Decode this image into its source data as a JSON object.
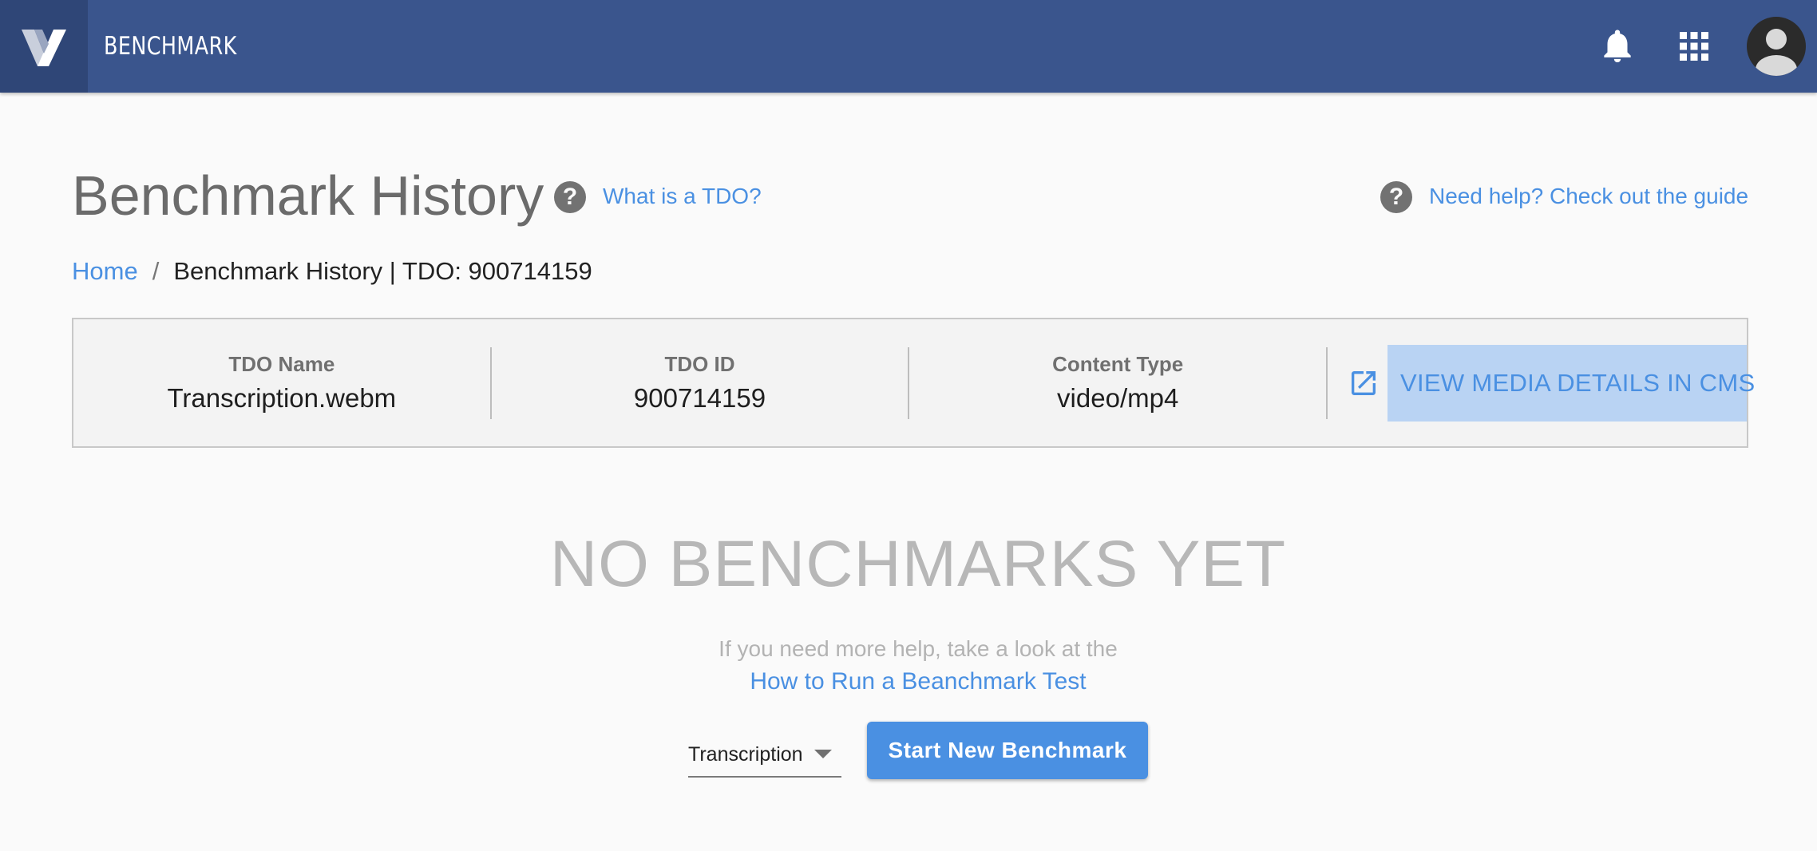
{
  "appbar": {
    "title": "BENCHMARK",
    "logo_icon": "veritone-v-logo",
    "notifications_icon": "bell-icon",
    "apps_icon": "apps-grid-icon",
    "avatar_icon": "user-avatar-icon",
    "color": "#3a558d"
  },
  "header": {
    "title": "Benchmark History",
    "tdo_help_link": "What is a TDO?",
    "guide_link": "Need help? Check out the guide",
    "help_icon": "help-circle-icon"
  },
  "breadcrumb": {
    "home": "Home",
    "separator": "/",
    "current": "Benchmark History | TDO: 900714159"
  },
  "info": {
    "tdo_name_label": "TDO Name",
    "tdo_name_value": "Transcription.webm",
    "tdo_id_label": "TDO ID",
    "tdo_id_value": "900714159",
    "content_type_label": "Content Type",
    "content_type_value": "video/mp4",
    "cms_button_label": "VIEW MEDIA DETAILS IN CMS",
    "cms_icon": "open-in-new-icon"
  },
  "empty_state": {
    "title": "NO BENCHMARKS YET",
    "help_text": "If you need more help, take a look at the",
    "help_link": "How to Run a Beanchmark Test"
  },
  "controls": {
    "engine_select_value": "Transcription",
    "start_button_label": "Start New Benchmark"
  },
  "colors": {
    "accent": "#4a90e2",
    "header_bg": "#3a558d",
    "selection_highlight": "#b9d3f3"
  }
}
